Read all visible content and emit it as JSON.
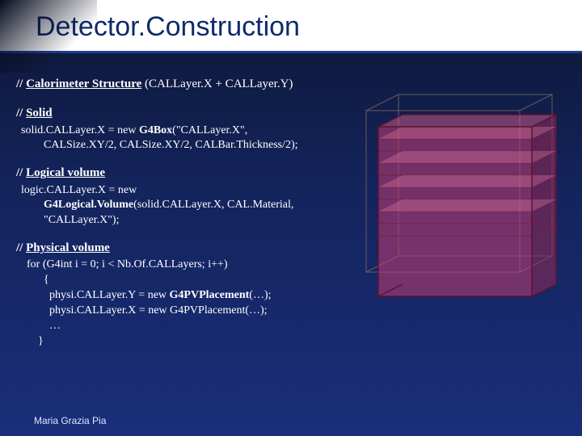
{
  "title": "Detector.Construction",
  "sections": {
    "calorimeter": {
      "prefix": "//",
      "label": "Calorimeter Structure",
      "extra": " (CALLayer.X + CALLayer.Y)"
    },
    "solid": {
      "prefix": "//",
      "label": "Solid",
      "code_line1": "solid.CALLayer.X = new ",
      "code_kw1": "G4Box",
      "code_line1b": "(\"CALLayer.X\",",
      "code_line2": "        CALSize.XY/2, CALSize.XY/2, CALBar.Thickness/2);"
    },
    "logical": {
      "prefix": "//",
      "label": "Logical volume",
      "code_line1": "logic.CALLayer.X = new",
      "code_line2a": "        ",
      "code_kw2": "G4Logical.Volume",
      "code_line2b": "(solid.CALLayer.X, CAL.Material,",
      "code_line3": "        \"CALLayer.X\");"
    },
    "physical": {
      "prefix": "//",
      "label": "Physical volume",
      "code_line1": "  for (G4int i = 0; i < Nb.Of.CALLayers; i++)",
      "code_line2": "        {",
      "code_line3a": "          physi.CALLayer.Y = new ",
      "code_kw3": "G4PVPlacement",
      "code_line3b": "(…);",
      "code_line4": "          physi.CALLayer.X = new G4PVPlacement(…);",
      "code_line5": "          …",
      "code_line6": "      }"
    }
  },
  "footer": "Maria Grazia Pia"
}
